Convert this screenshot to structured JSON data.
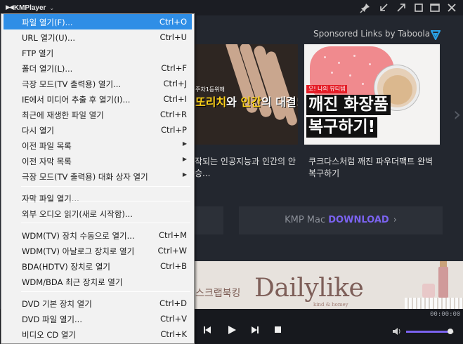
{
  "app": {
    "title": "KMPlayer"
  },
  "menu": {
    "items": [
      {
        "label": "파일 열기(F)...",
        "shortcut": "Ctrl+O",
        "selected": true
      },
      {
        "label": "URL 열기(U)...",
        "shortcut": "Ctrl+U"
      },
      {
        "label": "FTP 열기",
        "shortcut": ""
      },
      {
        "label": "폴더 열기(L)...",
        "shortcut": "Ctrl+F"
      },
      {
        "label": "극장 모드(TV 출력용) 열기...",
        "shortcut": "Ctrl+J"
      },
      {
        "label": "IE에서 미디어 추출 후 열기(I)...",
        "shortcut": "Ctrl+I"
      },
      {
        "label": "최근에 재생한 파일 열기",
        "shortcut": "Ctrl+R"
      },
      {
        "label": "다시 열기",
        "shortcut": "Ctrl+P"
      },
      {
        "label": "이전 파일 목록",
        "submenu": true
      },
      {
        "label": "이전 자막 목록",
        "submenu": true
      },
      {
        "label": "극장 모드(TV 출력용) 대화 상자 열기",
        "submenu": true
      },
      {
        "label": "자막 파일 열기...",
        "shortcut": ""
      },
      {
        "label": "외부 오디오 읽기(새로 시작함)...",
        "shortcut": ""
      },
      {
        "label": "WDM(TV) 장치 수동으로 열기...",
        "shortcut": "Ctrl+M"
      },
      {
        "label": "WDM(TV) 아날로그 장치로 열기",
        "shortcut": "Ctrl+W"
      },
      {
        "label": "BDA(HDTV) 장치로 열기",
        "shortcut": "Ctrl+B"
      },
      {
        "label": "WDM/BDA 최근 장치로 열기",
        "shortcut": ""
      },
      {
        "label": "DVD 기본 장치 열기",
        "shortcut": "Ctrl+D"
      },
      {
        "label": "DVD 파일 열기...",
        "shortcut": "Ctrl+V"
      },
      {
        "label": "비디오 CD 열기",
        "shortcut": "Ctrl+K"
      }
    ]
  },
  "ads": {
    "sponsored": "Sponsored Links by Taboola",
    "card1": {
      "image_small": "주차1등위해",
      "image_title_a": "또리치",
      "image_title_b": "와 ",
      "image_title_c": "인간",
      "image_title_d": "의 대결!",
      "caption": "작되는 인공지능과 인간의 안 승..."
    },
    "card2": {
      "image_tag": "오! 나의 뷰티템",
      "image_line1": "깨진 화장품",
      "image_line2": "복구하기!",
      "caption": "쿠크다스처럼 깨진 파우더팩트 완벽 복구하기"
    },
    "download": {
      "prefix": "KMP Mac ",
      "highlight": "DOWNLOAD",
      "arrow": "›"
    },
    "banner": {
      "korean": "스크랩북킹",
      "brand": "Dailylike",
      "sub": "kind & homey"
    }
  },
  "player": {
    "time": "00:00:00",
    "volume_fraction": 0.92
  },
  "colors": {
    "accent": "#7b63f0",
    "selection": "#2f8ee6",
    "background": "#23272f"
  },
  "icons": {
    "titlebar": [
      "pin-icon",
      "minimize-to-corner-icon",
      "expand-icon",
      "restore-icon",
      "maximize-icon",
      "close-icon"
    ],
    "controls": [
      "previous-icon",
      "play-icon",
      "next-icon",
      "stop-icon",
      "volume-icon"
    ]
  }
}
